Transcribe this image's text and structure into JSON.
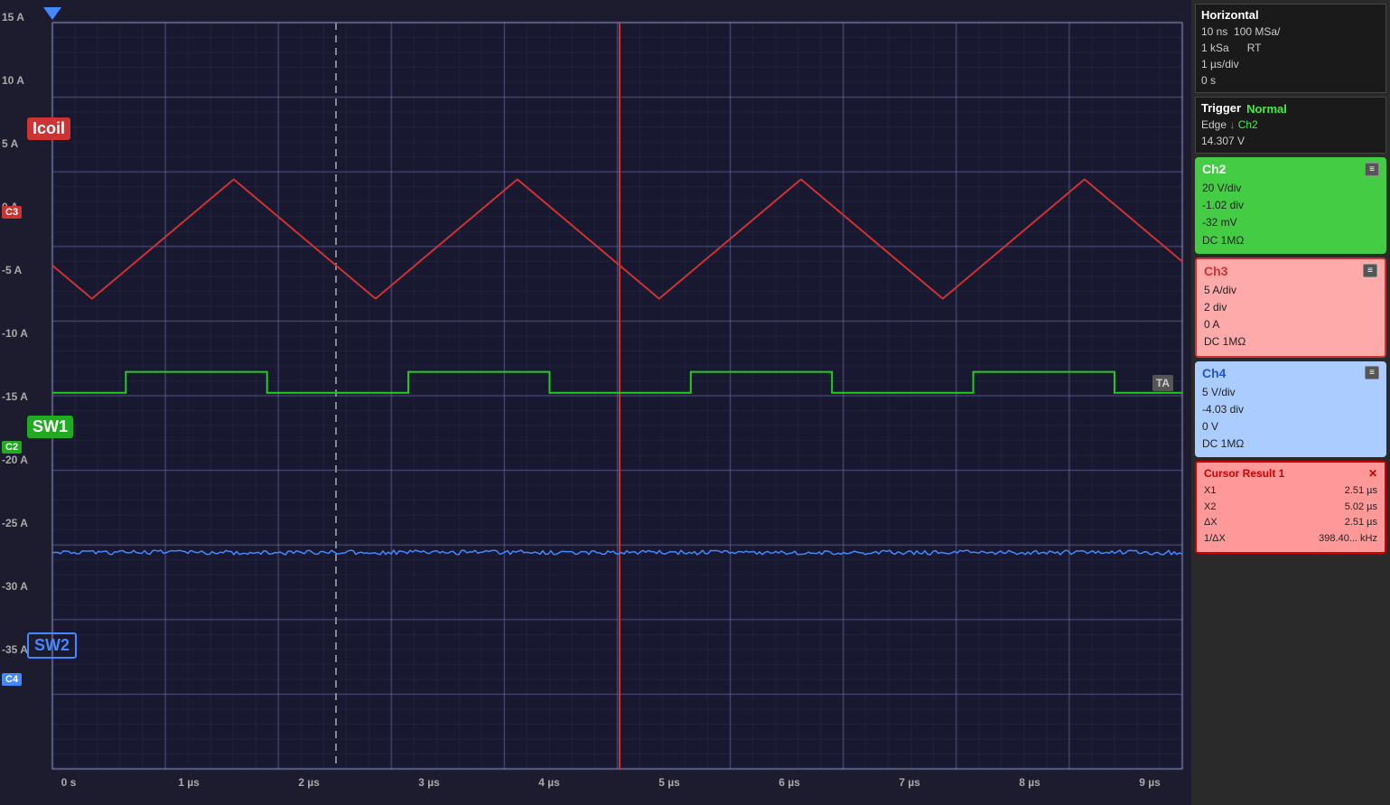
{
  "horizontal": {
    "title": "Horizontal",
    "time_per_div": "10 ns",
    "sample_rate": "100 MSa/",
    "samples": "1 kSa",
    "mode": "RT",
    "us_per_div": "1 µs/div",
    "offset": "0 s"
  },
  "trigger": {
    "title": "Trigger",
    "mode": "Normal",
    "type": "Edge",
    "channel": "Ch2",
    "level": "14.307 V"
  },
  "ch2": {
    "title": "Ch2",
    "v_div": "20 V/div",
    "div_offset": "-1.02 div",
    "offset_v": "-32 mV",
    "coupling": "DC 1MΩ"
  },
  "ch3": {
    "title": "Ch3",
    "a_div": "5 A/div",
    "div": "2 div",
    "offset": "0 A",
    "coupling": "DC 1MΩ"
  },
  "ch4": {
    "title": "Ch4",
    "v_div": "5 V/div",
    "div_offset": "-4.03 div",
    "offset_v": "0 V",
    "coupling": "DC 1MΩ"
  },
  "cursor_result": {
    "title": "Cursor Result 1",
    "x1": "2.51 µs",
    "x2": "5.02 µs",
    "dx": "2.51 µs",
    "inv_dx": "398.40... kHz"
  },
  "screen_labels": {
    "icoil": "Icoil",
    "sw1": "SW1",
    "sw2": "SW2"
  },
  "y_axis": {
    "labels": [
      "15 A",
      "10 A",
      "5 A",
      "0 A",
      "-5 A",
      "-10 A",
      "-15 A",
      "-20 A",
      "-25 A",
      "-30 A",
      "-35 A"
    ]
  },
  "x_axis": {
    "labels": [
      "0 s",
      "1 µs",
      "2 µs",
      "3 µs",
      "4 µs",
      "5 µs",
      "6 µs",
      "7 µs",
      "8 µs",
      "9 µs"
    ]
  },
  "ref_markers": {
    "c3": "C3",
    "c2": "C2",
    "c4": "C4"
  }
}
